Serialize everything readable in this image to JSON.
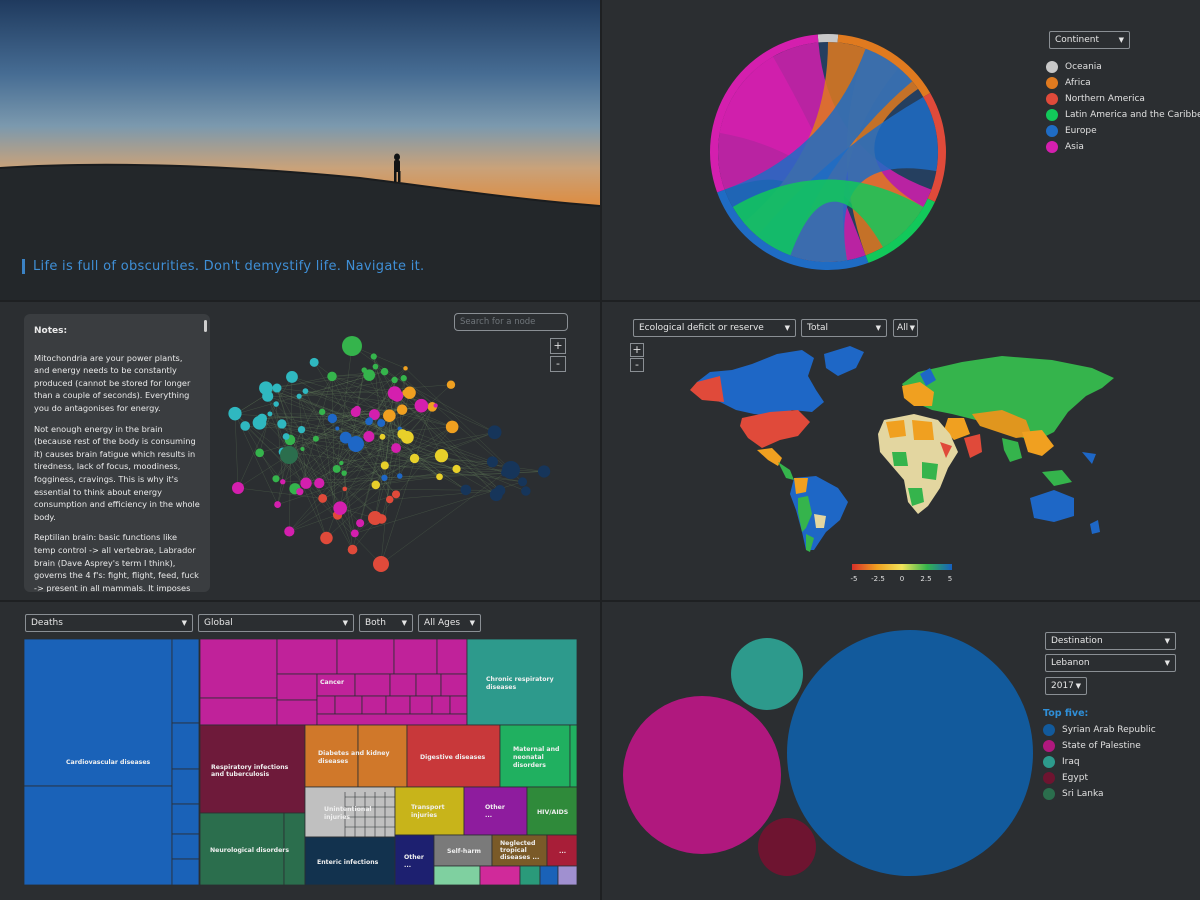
{
  "hero": {
    "quote": "Life is full of obscurities. Don't demystify life. Navigate it."
  },
  "chord": {
    "filter": "Continent",
    "legend": [
      {
        "label": "Oceania",
        "color": "#c8c8c8"
      },
      {
        "label": "Africa",
        "color": "#e07a1f"
      },
      {
        "label": "Northern America",
        "color": "#e04a3a"
      },
      {
        "label": "Latin America and the Caribbean",
        "color": "#12c85a"
      },
      {
        "label": "Europe",
        "color": "#1f6cc4"
      },
      {
        "label": "Asia",
        "color": "#d41fae"
      }
    ]
  },
  "network": {
    "notes_title": "Notes:",
    "notes": [
      "Mitochondria are your power plants, and energy needs to be constantly produced (cannot be stored for longer than a couple of seconds). Everything you do antagonises for energy.",
      "Not enough energy in the brain (because rest of the body is consuming it) causes brain fatigue which results in tiredness, lack of focus, moodiness, fogginess, cravings. This is why it's essential to think about energy consumption and efficiency in the whole body.",
      "Reptilian brain: basic functions like temp control -> all vertebrae, Labrador brain (Dave Asprey's term I think), governs the 4 f's: fight, flight, feed, fuck -> present in all mammals. It imposes an"
    ],
    "search_placeholder": "Search for a node",
    "zoom_in": "+",
    "zoom_out": "-"
  },
  "map": {
    "metric": "Ecological deficit or reserve",
    "mode": "Total",
    "region": "All",
    "zoom_in": "+",
    "zoom_out": "-",
    "scale_ticks": [
      "-5",
      "-2.5",
      "0",
      "2.5",
      "5"
    ]
  },
  "treemap": {
    "filters": {
      "measure": "Deaths",
      "location": "Global",
      "sex": "Both",
      "age": "All Ages"
    },
    "labels": {
      "cardio": "Cardiovascular diseases",
      "cancer": "Cancer",
      "chronic": "Chronic respiratory diseases",
      "resp": "Respiratory infections and tuberculosis",
      "diabetes": "Diabetes and kidney diseases",
      "digestive": "Digestive diseases",
      "maternal": "Maternal and neonatal disorders",
      "neuro": "Neurological disorders",
      "unint": "Unintentional injuries",
      "transport": "Transport injuries",
      "other1": "Other",
      "other1b": "...",
      "hiv": "HIV/AIDS",
      "enteric": "Enteric infections",
      "other2": "Other",
      "other2b": "...",
      "selfharm": "Self-harm",
      "ntd": "Neglected tropical diseases ...",
      "dots": "..."
    }
  },
  "bubble": {
    "filters": {
      "direction": "Destination",
      "country": "Lebanon",
      "year": "2017"
    },
    "top_five_title": "Top five:",
    "legend": [
      {
        "label": "Syrian Arab Republic",
        "color": "#125a9c"
      },
      {
        "label": "State of Palestine",
        "color": "#b0187e"
      },
      {
        "label": "Iraq",
        "color": "#2d9a8c"
      },
      {
        "label": "Egypt",
        "color": "#6e1430"
      },
      {
        "label": "Sri Lanka",
        "color": "#2b6e4d"
      }
    ]
  }
}
